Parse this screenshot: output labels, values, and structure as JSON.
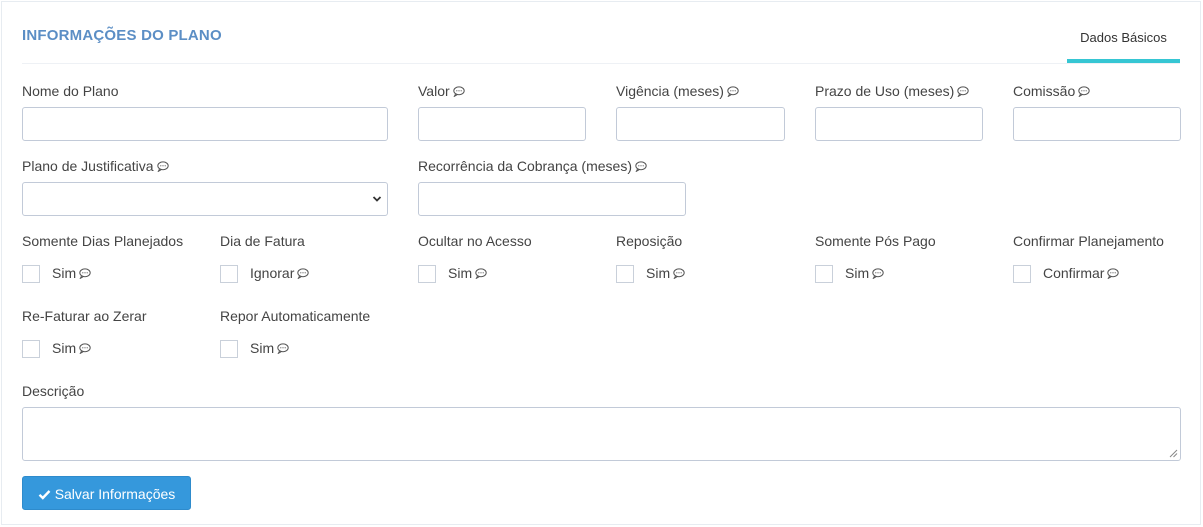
{
  "panel": {
    "title": "INFORMAÇÕES DO PLANO",
    "tab_label": "Dados Básicos"
  },
  "fields": {
    "nome_do_plano": {
      "label": "Nome do Plano",
      "value": ""
    },
    "valor": {
      "label": "Valor",
      "value": ""
    },
    "vigencia": {
      "label": "Vigência (meses)",
      "value": ""
    },
    "prazo_de_uso": {
      "label": "Prazo de Uso (meses)",
      "value": ""
    },
    "comissao": {
      "label": "Comissão",
      "value": ""
    },
    "plano_de_justificativa": {
      "label": "Plano de Justificativa",
      "selected": ""
    },
    "recorrencia": {
      "label": "Recorrência da Cobrança (meses)",
      "value": ""
    },
    "descricao": {
      "label": "Descrição",
      "value": ""
    }
  },
  "checkboxes": {
    "somente_dias_planejados": {
      "label": "Somente Dias Planejados",
      "option": "Sim",
      "checked": false
    },
    "dia_de_fatura": {
      "label": "Dia de Fatura",
      "option": "Ignorar",
      "checked": false
    },
    "ocultar_no_acesso": {
      "label": "Ocultar no Acesso",
      "option": "Sim",
      "checked": false
    },
    "reposicao": {
      "label": "Reposição",
      "option": "Sim",
      "checked": false
    },
    "somente_pos_pago": {
      "label": "Somente Pós Pago",
      "option": "Sim",
      "checked": false
    },
    "confirmar_planejamento": {
      "label": "Confirmar Planejamento",
      "option": "Confirmar",
      "checked": false
    },
    "re_faturar_ao_zerar": {
      "label": "Re-Faturar ao Zerar",
      "option": "Sim",
      "checked": false
    },
    "repor_automaticamente": {
      "label": "Repor Automaticamente",
      "option": "Sim",
      "checked": false
    }
  },
  "actions": {
    "save_label": "Salvar Informações"
  },
  "icons": {
    "help": "chat-bubble-icon",
    "save": "check-icon",
    "select": "chevron-down-icon"
  },
  "colors": {
    "title": "#5b8ec5",
    "tab_underline": "#36c6d3",
    "button": "#3598dc",
    "input_border": "#c2cad8"
  }
}
